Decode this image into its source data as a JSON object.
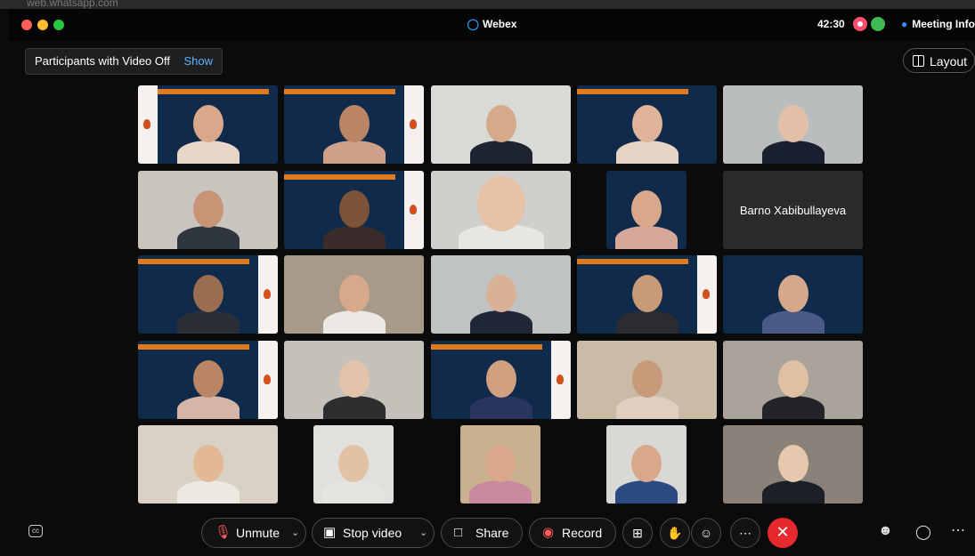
{
  "browser": {
    "url_fragment": "web.whatsapp.com"
  },
  "window": {
    "title": "Webex",
    "timer": "42:30",
    "meeting_info": "Meeting Info"
  },
  "participants_video_off": {
    "label": "Participants with Video Off",
    "action": "Show"
  },
  "layout_button": {
    "label": "Layout"
  },
  "tiles": [
    {
      "name": "",
      "video": "on"
    },
    {
      "name": "",
      "video": "on"
    },
    {
      "name": "",
      "video": "on"
    },
    {
      "name": "",
      "video": "on"
    },
    {
      "name": "",
      "video": "on"
    },
    {
      "name": "",
      "video": "on"
    },
    {
      "name": "",
      "video": "on"
    },
    {
      "name": "",
      "video": "on"
    },
    {
      "name": "",
      "video": "on"
    },
    {
      "name": "Barno Xabibullayeva",
      "video": "off"
    },
    {
      "name": "",
      "video": "on"
    },
    {
      "name": "",
      "video": "on"
    },
    {
      "name": "",
      "video": "on"
    },
    {
      "name": "",
      "video": "on"
    },
    {
      "name": "",
      "video": "on"
    },
    {
      "name": "",
      "video": "on"
    },
    {
      "name": "",
      "video": "on"
    },
    {
      "name": "",
      "video": "on"
    },
    {
      "name": "",
      "video": "on"
    },
    {
      "name": "",
      "video": "on"
    },
    {
      "name": "",
      "video": "on"
    },
    {
      "name": "",
      "video": "on"
    },
    {
      "name": "",
      "video": "on"
    },
    {
      "name": "",
      "video": "on"
    },
    {
      "name": "",
      "video": "on"
    }
  ],
  "toolbar": {
    "unmute": "Unmute",
    "stop_video": "Stop video",
    "share": "Share",
    "record": "Record"
  },
  "colors": {
    "accent": "#5ab4ff",
    "end_call": "#e5292f",
    "banner": "#e07a1f",
    "background_navy": "#0f2a4a"
  }
}
